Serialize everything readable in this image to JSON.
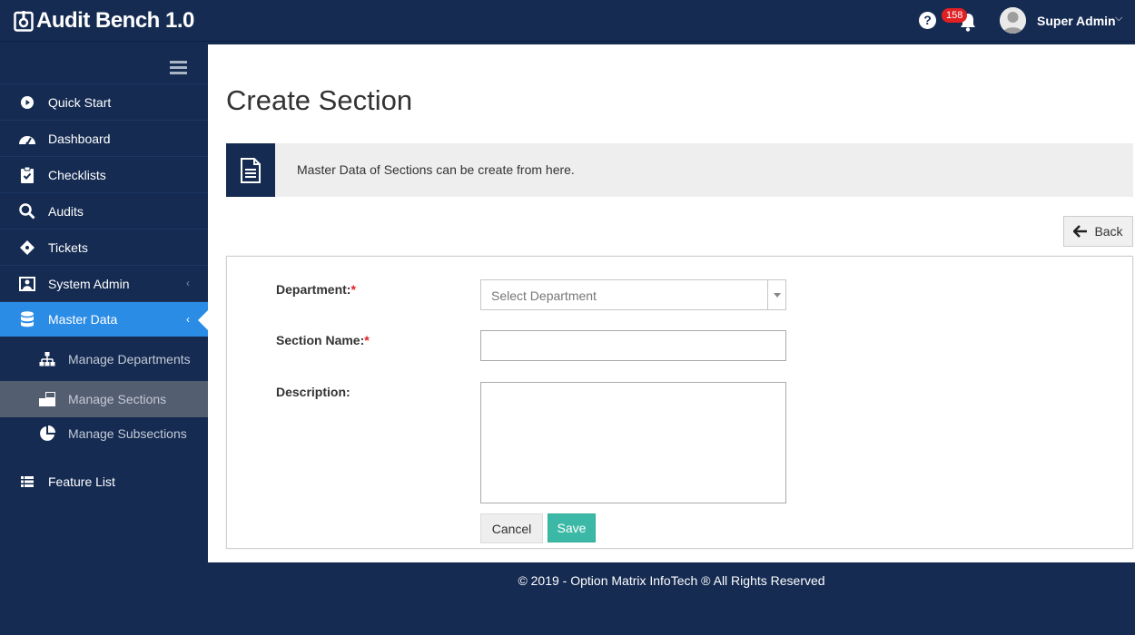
{
  "app": {
    "title": "Audit Bench 1.0"
  },
  "header": {
    "help_label": "?",
    "notification_count": "158",
    "user_name": "Super Admin",
    "user_caret": "⌵"
  },
  "sidebar": {
    "items": [
      {
        "label": "Quick Start",
        "icon": "play-circle-icon"
      },
      {
        "label": "Dashboard",
        "icon": "speedometer-icon"
      },
      {
        "label": "Checklists",
        "icon": "clipboard-check-icon"
      },
      {
        "label": "Audits",
        "icon": "magnifier-icon"
      },
      {
        "label": "Tickets",
        "icon": "ticket-icon"
      },
      {
        "label": "System Admin",
        "icon": "user-board-icon",
        "chevron": "‹"
      },
      {
        "label": "Master Data",
        "icon": "database-icon",
        "chevron": "‹",
        "active": true
      },
      {
        "label": "Feature List",
        "icon": "list-icon"
      }
    ],
    "subitems": [
      {
        "label": "Manage Departments",
        "icon": "sitemap-icon"
      },
      {
        "label": "Manage Sections",
        "icon": "sections-icon",
        "selected": true
      },
      {
        "label": "Manage Subsections",
        "icon": "pie-chart-icon"
      }
    ]
  },
  "page": {
    "title": "Create Section",
    "info_text": "Master Data of Sections can be create from here.",
    "back_label": "Back"
  },
  "form": {
    "department_label": "Department:",
    "section_name_label": "Section Name:",
    "description_label": "Description:",
    "required_mark": "*",
    "department_placeholder": "Select Department",
    "section_name_value": "",
    "description_value": "",
    "cancel_label": "Cancel",
    "save_label": "Save"
  },
  "footer": {
    "text": "© 2019 - Option Matrix InfoTech ® All Rights Reserved"
  },
  "colors": {
    "navy": "#152b52",
    "accent_blue": "#2b8ce6",
    "save_teal": "#3cb9a6",
    "badge_red": "#e02124"
  }
}
